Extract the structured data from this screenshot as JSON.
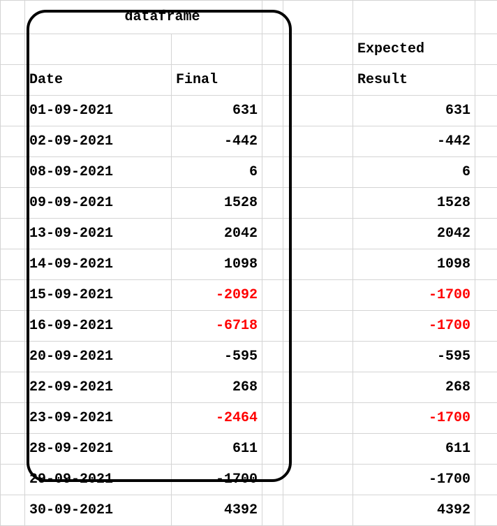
{
  "title": "dataframe",
  "columns": {
    "date": "Date",
    "final": "Final",
    "expected": "Expected",
    "result": "Result"
  },
  "rows": [
    {
      "date": "01-09-2021",
      "final": "631",
      "final_neg": false,
      "result": "631",
      "result_neg": false
    },
    {
      "date": "02-09-2021",
      "final": "-442",
      "final_neg": false,
      "result": "-442",
      "result_neg": false
    },
    {
      "date": "08-09-2021",
      "final": "6",
      "final_neg": false,
      "result": "6",
      "result_neg": false
    },
    {
      "date": "09-09-2021",
      "final": "1528",
      "final_neg": false,
      "result": "1528",
      "result_neg": false
    },
    {
      "date": "13-09-2021",
      "final": "2042",
      "final_neg": false,
      "result": "2042",
      "result_neg": false
    },
    {
      "date": "14-09-2021",
      "final": "1098",
      "final_neg": false,
      "result": "1098",
      "result_neg": false
    },
    {
      "date": "15-09-2021",
      "final": "-2092",
      "final_neg": true,
      "result": "-1700",
      "result_neg": true
    },
    {
      "date": "16-09-2021",
      "final": "-6718",
      "final_neg": true,
      "result": "-1700",
      "result_neg": true
    },
    {
      "date": "20-09-2021",
      "final": "-595",
      "final_neg": false,
      "result": "-595",
      "result_neg": false
    },
    {
      "date": "22-09-2021",
      "final": "268",
      "final_neg": false,
      "result": "268",
      "result_neg": false
    },
    {
      "date": "23-09-2021",
      "final": "-2464",
      "final_neg": true,
      "result": "-1700",
      "result_neg": true
    },
    {
      "date": "28-09-2021",
      "final": "611",
      "final_neg": false,
      "result": "611",
      "result_neg": false
    },
    {
      "date": "29-09-2021",
      "final": "-1700",
      "final_neg": false,
      "result": "-1700",
      "result_neg": false
    },
    {
      "date": "30-09-2021",
      "final": "4392",
      "final_neg": false,
      "result": "4392",
      "result_neg": false
    }
  ]
}
